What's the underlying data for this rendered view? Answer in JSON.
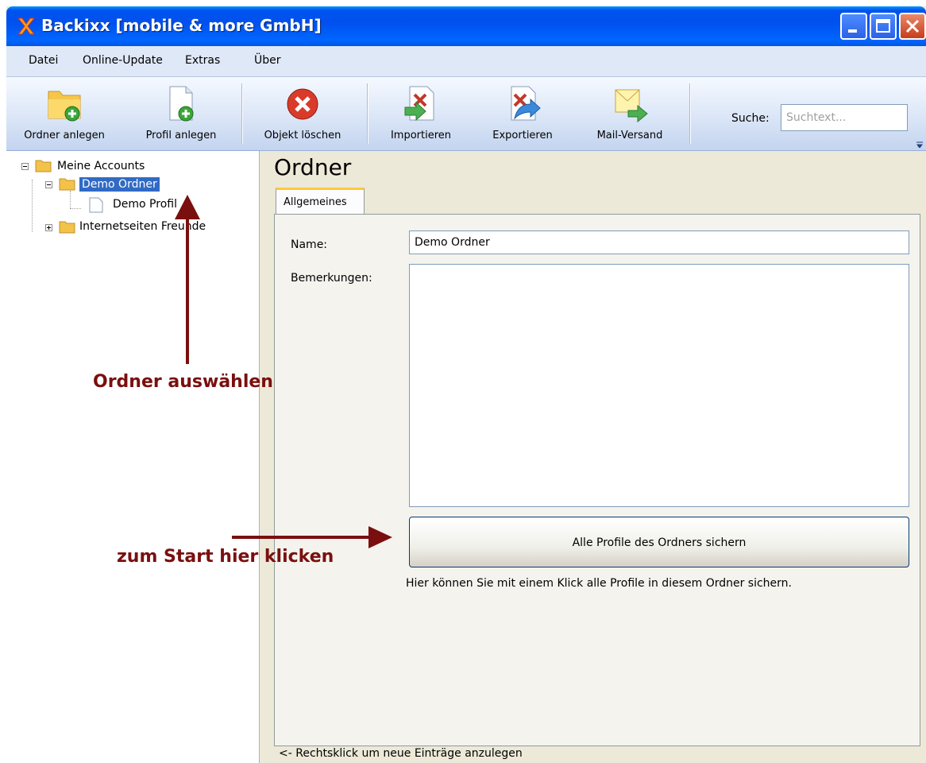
{
  "window": {
    "title": "Backixx [mobile & more GmbH]"
  },
  "menu": [
    "Datei",
    "Online-Update",
    "Extras",
    "Über"
  ],
  "toolbar": {
    "buttons": [
      {
        "label": "Ordner anlegen",
        "icon": "folder-add-icon"
      },
      {
        "label": "Profil anlegen",
        "icon": "profile-add-icon"
      },
      {
        "label": "Objekt löschen",
        "icon": "delete-icon"
      },
      {
        "label": "Importieren",
        "icon": "import-icon"
      },
      {
        "label": "Exportieren",
        "icon": "export-icon"
      },
      {
        "label": "Mail-Versand",
        "icon": "mail-send-icon"
      }
    ],
    "search_label": "Suche:",
    "search_placeholder": "Suchtext..."
  },
  "tree": {
    "root": "Meine Accounts",
    "selected": "Demo Ordner",
    "child": "Demo Profil",
    "other": "Internetseiten Freunde"
  },
  "pane": {
    "title": "Ordner",
    "tab": "Allgemeines",
    "name_label": "Name:",
    "name_value": "Demo Ordner",
    "remarks_label": "Bemerkungen:",
    "remarks_value": "",
    "action_button": "Alle Profile des Ordners sichern",
    "hint": "Hier können Sie mit einem Klick alle Profile in diesem Ordner sichern.",
    "footer": "<- Rechtsklick um neue Einträge anzulegen"
  },
  "annotations": {
    "select_folder": "Ordner auswählen",
    "click_start": "zum Start hier klicken"
  },
  "colors": {
    "annotation": "#7a0f0f",
    "selection": "#316ac5",
    "titlebar": "#0054e3"
  }
}
